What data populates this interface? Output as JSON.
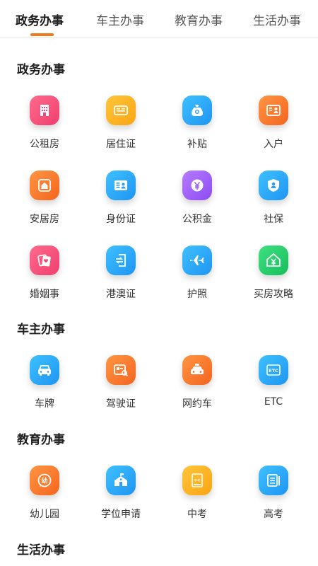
{
  "tabs": [
    "政务办事",
    "车主办事",
    "教育办事",
    "生活办事"
  ],
  "active_tab": 0,
  "accent_color": "#f37a1f",
  "sections": [
    {
      "title": "政务办事",
      "items": [
        {
          "label": "公租房",
          "icon": "building-icon",
          "color": "pink"
        },
        {
          "label": "居住证",
          "icon": "id-card-icon",
          "color": "yellow"
        },
        {
          "label": "补贴",
          "icon": "money-bag-icon",
          "color": "blue"
        },
        {
          "label": "入户",
          "icon": "profile-card-icon",
          "color": "orange"
        },
        {
          "label": "安居房",
          "icon": "house-icon",
          "color": "orange"
        },
        {
          "label": "身份证",
          "icon": "identity-card-icon",
          "color": "blue"
        },
        {
          "label": "公积金",
          "icon": "yuan-coin-icon",
          "color": "purple"
        },
        {
          "label": "社保",
          "icon": "shield-user-icon",
          "color": "blue"
        },
        {
          "label": "婚姻事",
          "icon": "marriage-cert-icon",
          "color": "pink"
        },
        {
          "label": "港澳证",
          "icon": "exchange-doc-icon",
          "color": "blue"
        },
        {
          "label": "护照",
          "icon": "airplane-icon",
          "color": "blue"
        },
        {
          "label": "买房攻略",
          "icon": "yuan-house-icon",
          "color": "green"
        }
      ]
    },
    {
      "title": "车主办事",
      "items": [
        {
          "label": "车牌",
          "icon": "car-icon",
          "color": "blue"
        },
        {
          "label": "驾驶证",
          "icon": "license-search-icon",
          "color": "orange"
        },
        {
          "label": "网约车",
          "icon": "taxi-icon",
          "color": "orange"
        },
        {
          "label": "ETC",
          "icon": "etc-icon",
          "color": "blue",
          "icon_text": "ETC"
        }
      ]
    },
    {
      "title": "教育办事",
      "items": [
        {
          "label": "幼儿园",
          "icon": "kindergarten-icon",
          "color": "orange",
          "icon_text": "幼"
        },
        {
          "label": "学位申请",
          "icon": "school-icon",
          "color": "blue"
        },
        {
          "label": "中考",
          "icon": "exam-book-icon",
          "color": "yellow",
          "icon_text": "中考"
        },
        {
          "label": "高考",
          "icon": "notebook-icon",
          "color": "blue"
        }
      ]
    },
    {
      "title": "生活办事",
      "items": []
    }
  ]
}
